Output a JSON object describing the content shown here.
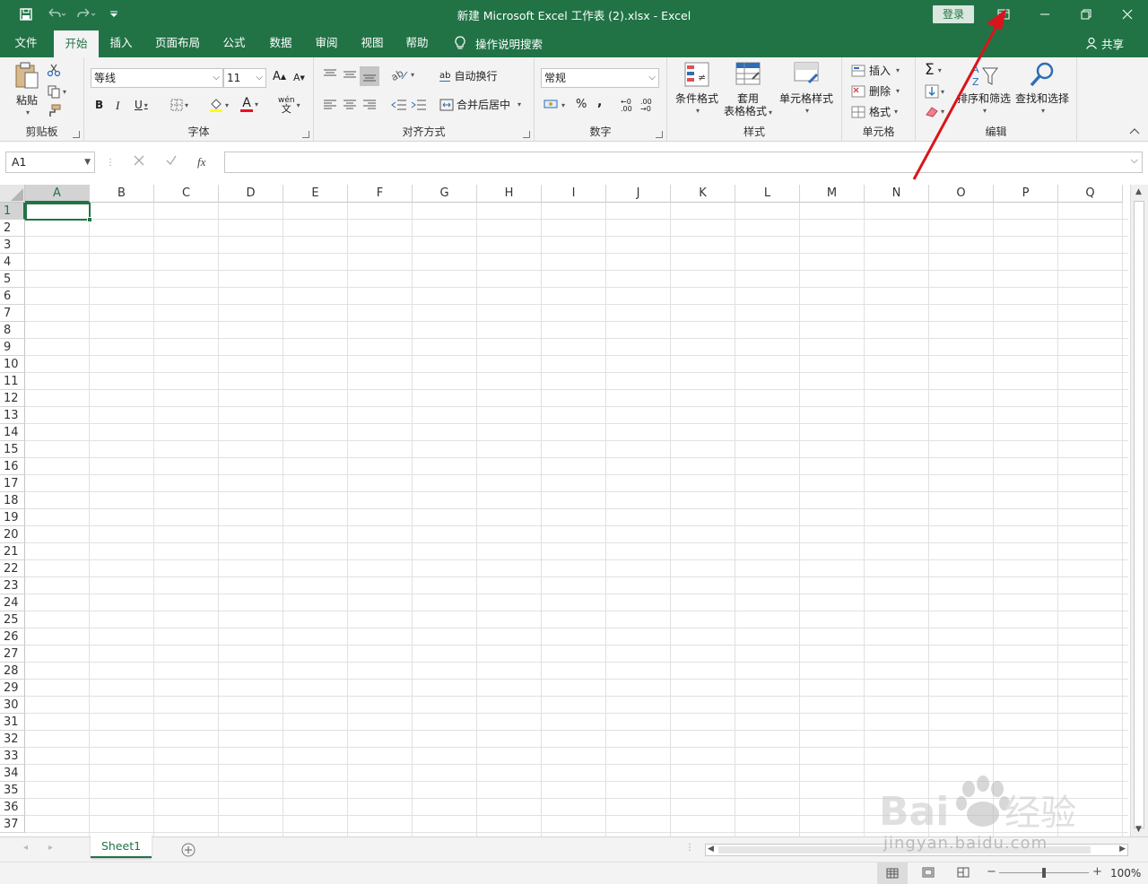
{
  "window": {
    "title": "新建 Microsoft Excel 工作表 (2).xlsx  -  Excel",
    "login_label": "登录"
  },
  "menu": {
    "tabs": [
      {
        "label": "文件"
      },
      {
        "label": "开始"
      },
      {
        "label": "插入"
      },
      {
        "label": "页面布局"
      },
      {
        "label": "公式"
      },
      {
        "label": "数据"
      },
      {
        "label": "审阅"
      },
      {
        "label": "视图"
      },
      {
        "label": "帮助"
      }
    ],
    "tell_me": "操作说明搜索",
    "share": "共享"
  },
  "ribbon": {
    "clipboard": {
      "paste": "粘贴",
      "label": "剪贴板"
    },
    "font": {
      "name": "等线",
      "size": "11",
      "label": "字体",
      "grow": "A",
      "shrink": "A",
      "bold": "B",
      "italic": "I",
      "underline": "U",
      "font_color": "A",
      "phonetic": "wén"
    },
    "alignment": {
      "wrap": "自动换行",
      "merge": "合并后居中",
      "label": "对齐方式",
      "wrap_icon": "ab"
    },
    "number": {
      "format": "常规",
      "percent": "%",
      "comma": ",",
      "label": "数字",
      "inc_decimal": ".00",
      "dec_decimal": ".00"
    },
    "styles": {
      "conditional": "条件格式",
      "table_line1": "套用",
      "table_line2": "表格格式",
      "cell_styles": "单元格样式",
      "label": "样式"
    },
    "cells": {
      "insert": "插入",
      "delete": "删除",
      "format": "格式",
      "label": "单元格"
    },
    "editing": {
      "autosum": "Σ",
      "sort_filter": "排序和筛选",
      "find_select": "查找和选择",
      "label": "编辑"
    }
  },
  "formula_bar": {
    "name_box": "A1",
    "fx": "fx",
    "value": ""
  },
  "sheet": {
    "columns": [
      "A",
      "B",
      "C",
      "D",
      "E",
      "F",
      "G",
      "H",
      "I",
      "J",
      "K",
      "L",
      "M",
      "N",
      "O",
      "P",
      "Q"
    ],
    "rows": [
      "1",
      "2",
      "3",
      "4",
      "5",
      "6",
      "7",
      "8",
      "9",
      "10",
      "11",
      "12",
      "13",
      "14",
      "15",
      "16",
      "17",
      "18",
      "19",
      "20",
      "21",
      "22",
      "23",
      "24",
      "25",
      "26",
      "27",
      "28",
      "29",
      "30",
      "31",
      "32",
      "33",
      "34",
      "35",
      "36",
      "37"
    ],
    "active_cell": "A1",
    "tab_name": "Sheet1"
  },
  "status": {
    "zoom": "100%",
    "zoom_minus": "−",
    "zoom_plus": "+"
  },
  "watermark": {
    "brand": "Bai",
    "brand_cn": "经验",
    "url": "jingyan.baidu.com"
  },
  "colors": {
    "excel_green": "#217346",
    "annotation_red": "#d9151b"
  }
}
